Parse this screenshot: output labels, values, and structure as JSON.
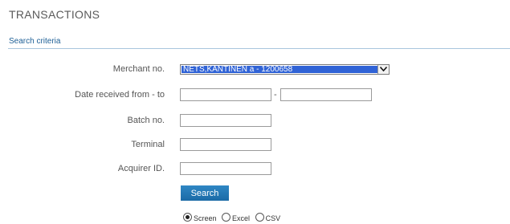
{
  "page": {
    "title": "TRANSACTIONS",
    "section_label": "Search criteria"
  },
  "form": {
    "merchant": {
      "label": "Merchant no.",
      "selected": "NETS,KANTINEN a - 1200658"
    },
    "date_received": {
      "label": "Date received from - to",
      "from_value": "",
      "to_value": "",
      "separator": "-"
    },
    "batch": {
      "label": "Batch no.",
      "value": ""
    },
    "terminal": {
      "label": "Terminal",
      "value": ""
    },
    "acquirer": {
      "label": "Acquirer ID.",
      "value": ""
    },
    "search_button": "Search",
    "output_options": [
      {
        "label": "Screen",
        "checked": true
      },
      {
        "label": "Excel",
        "checked": false
      },
      {
        "label": "CSV",
        "checked": false
      }
    ]
  },
  "colors": {
    "section_label": "#1d5f96",
    "button": "#1a6aa6",
    "selected_highlight": "#3063d6"
  }
}
